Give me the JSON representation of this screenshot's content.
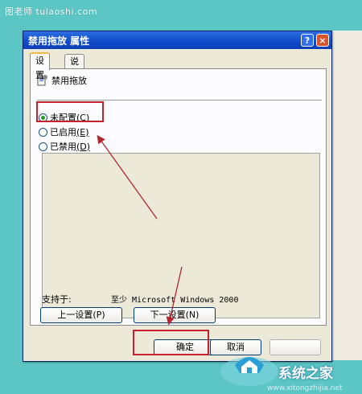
{
  "watermark": {
    "top_text": "图老师 tulaoshi.com"
  },
  "window": {
    "title": "禁用拖放 属性",
    "help_glyph": "?",
    "close_glyph": "×"
  },
  "tabs": [
    {
      "label": "设置",
      "active": true
    },
    {
      "label": "说明",
      "active": false
    }
  ],
  "policy": {
    "name": "禁用拖放"
  },
  "options": [
    {
      "label": "未配置",
      "key": "(C)",
      "selected": true
    },
    {
      "label": "已启用",
      "key": "(E)",
      "selected": false
    },
    {
      "label": "已禁用",
      "key": "(D)",
      "selected": false
    }
  ],
  "support": {
    "label": "支持于:",
    "value": "至少 Microsoft Windows 2000"
  },
  "buttons": {
    "prev": "上一设置(P)",
    "next": "下一设置(N)",
    "ok": "确定",
    "cancel": "取消"
  },
  "logo": {
    "brand": "系统之家",
    "sub": "www.xitongzhijia.net"
  },
  "colors": {
    "background": "#5cc6c4",
    "titlebar": "#1149c9",
    "annotation": "#c8202f",
    "dialog": "#ece9d8"
  }
}
